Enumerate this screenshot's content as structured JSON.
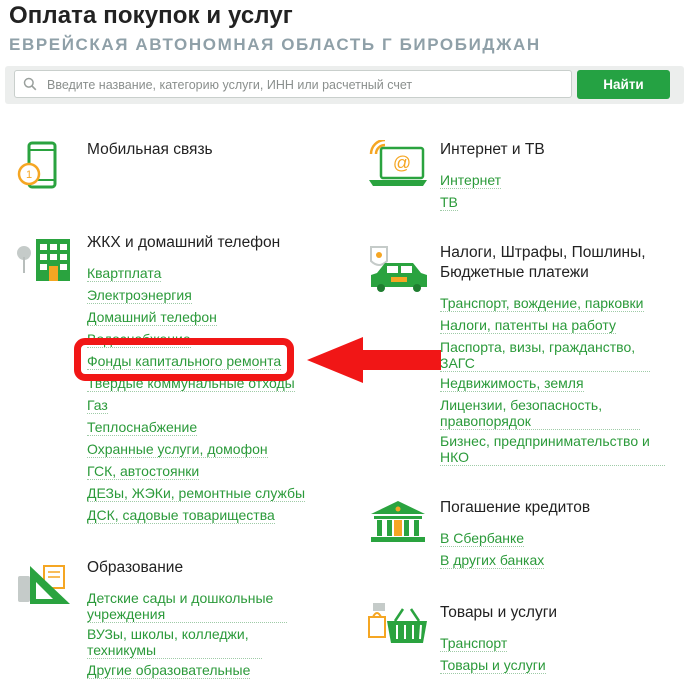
{
  "header": {
    "title": "Оплата покупок и услуг",
    "region": "Еврейская автономная область г Биробиджан"
  },
  "search": {
    "placeholder": "Введите название, категорию услуги, ИНН или расчетный счет",
    "button_label": "Найти"
  },
  "colors": {
    "accent": "#25a243",
    "link": "#2b9a3a",
    "highlight": "#f11616",
    "icon_orange": "#f5a623"
  },
  "categories": {
    "mobile": {
      "title": "Мобильная связь",
      "icon": "mobile-phone-icon",
      "links": []
    },
    "internet": {
      "title": "Интернет и ТВ",
      "icon": "laptop-wifi-icon",
      "links": [
        "Интернет",
        "ТВ"
      ]
    },
    "housing": {
      "title": "ЖКХ и домашний телефон",
      "icon": "house-icon",
      "links": [
        "Квартплата",
        "Электроэнергия",
        "Домашний телефон",
        "Водоснабжение",
        "Фонды капитального ремонта",
        "Твердые коммунальные отходы",
        "Газ",
        "Теплоснабжение",
        "Охранные услуги, домофон",
        "ГСК, автостоянки",
        "ДЕЗы, ЖЭКи, ремонтные службы",
        "ДСК, садовые товарищества"
      ]
    },
    "taxes": {
      "title_line1": "Налоги, Штрафы, Пошлины,",
      "title_line2": "Бюджетные платежи",
      "icon": "car-emblem-icon",
      "links": [
        "Транспорт, вождение, парковки",
        "Налоги, патенты на работу",
        "Паспорта, визы, гражданство, ЗАГС",
        "Недвижимость, земля",
        "Лицензии, безопасность, правопорядок",
        "Бизнес, предпринимательство и НКО"
      ]
    },
    "credits": {
      "title": "Погашение кредитов",
      "icon": "bank-icon",
      "links": [
        "В Сбербанке",
        "В других банках"
      ]
    },
    "education": {
      "title": "Образование",
      "icon": "ruler-triangle-icon",
      "links": [
        "Детские сады и дошкольные учреждения",
        "ВУЗы, школы, колледжи, техникумы",
        "Другие образовательные"
      ]
    },
    "goods": {
      "title": "Товары и услуги",
      "icon": "shopping-basket-icon",
      "links": [
        "Транспорт",
        "Товары и услуги"
      ]
    }
  }
}
